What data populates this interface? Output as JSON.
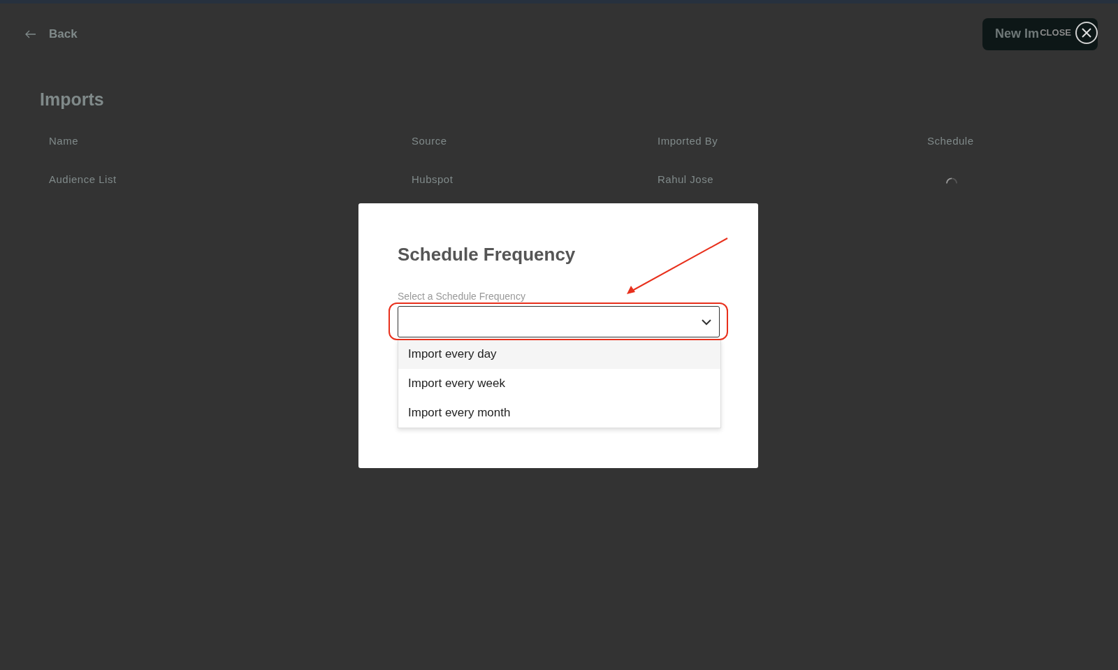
{
  "header": {
    "back_label": "Back",
    "new_button": "New Im",
    "close_label": "CLOSE"
  },
  "page": {
    "title": "Imports"
  },
  "table": {
    "columns": [
      "Name",
      "Source",
      "Imported By",
      "Schedule"
    ],
    "rows": [
      {
        "name": "Audience List",
        "source": "Hubspot",
        "imported_by": "Rahul Jose",
        "schedule_loading": true
      }
    ]
  },
  "modal": {
    "title": "Schedule Frequency",
    "field_label": "Select a Schedule Frequency",
    "expanded": true,
    "options": [
      {
        "label": "Import every day",
        "selected": true
      },
      {
        "label": "Import every week",
        "selected": false
      },
      {
        "label": "Import every month",
        "selected": false
      }
    ]
  }
}
